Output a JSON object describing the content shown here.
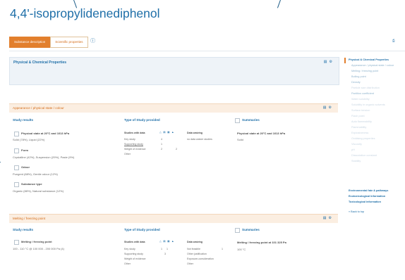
{
  "page": {
    "title": "4,4'-isopropylidenediphenol"
  },
  "tabs": [
    {
      "label": "Substance description",
      "active": true
    },
    {
      "label": "Scientific properties",
      "active": false
    }
  ],
  "info_icon": "info-icon",
  "physchem": {
    "title": "Physical & Chemical Properties"
  },
  "sections": [
    {
      "title": "Appearance / physical state / colour",
      "study_results_header": "Study results",
      "type_header": "Type of Study provided",
      "summaries_header": "Summaries",
      "results": [
        {
          "label": "Physical state at 20°C and 1013 hPa",
          "value": "Solid (78%), Liquid (22%)"
        },
        {
          "label": "Form",
          "value": "Crystalline (42%), Suspension (29%), Paste (9%)"
        },
        {
          "label": "Odour",
          "value": "Pungent (88%), Gentle odour (12%)"
        },
        {
          "label": "Substance type",
          "value": "Organic (88%), Natural substance (12%)"
        }
      ],
      "type_table": {
        "col_header": "Studies with data",
        "rows": [
          {
            "label": "Key study",
            "a": "4",
            "b": ""
          },
          {
            "label": "Supporting study",
            "a": "1",
            "b": ""
          },
          {
            "label": "Weight of evidence",
            "a": "2",
            "b": "2"
          },
          {
            "label": "Other",
            "a": "",
            "b": ""
          }
        ],
        "waiving_header": "Data waiving",
        "waiving_value": "no data waiver studies"
      },
      "summary": {
        "label": "Physical state at 20°C and 1013 hPa",
        "value": "Solid"
      }
    },
    {
      "title": "Melting / freezing point",
      "study_results_header": "Study results",
      "type_header": "Type of Study provided",
      "summaries_header": "Summaries",
      "results": [
        {
          "label": "Melting / freezing point",
          "value": "100 - 110 °C @ 100 000 - 200 000 Pa (4)"
        }
      ],
      "type_table": {
        "col_header": "Studies with data",
        "rows": [
          {
            "label": "Key study",
            "a": "1",
            "b": "1"
          },
          {
            "label": "Supporting study",
            "a": "3",
            "b": ""
          },
          {
            "label": "Weight of evidence",
            "a": "",
            "b": ""
          },
          {
            "label": "Other",
            "a": "",
            "b": ""
          }
        ],
        "waiving_header": "Data waiving",
        "waiving_rows": [
          {
            "label": "Not feasible",
            "a": "1"
          },
          {
            "label": "Other justification",
            "a": ""
          },
          {
            "label": "Exposure-consideration",
            "a": ""
          },
          {
            "label": "Other",
            "a": ""
          }
        ]
      },
      "summary": {
        "label": "Melting / freezing point at 101 325 Pa",
        "value": "100 °C"
      }
    }
  ],
  "sidebar": {
    "items": [
      {
        "label": "Physical & Chemical Properties",
        "style": "active"
      },
      {
        "label": "Appearance / physical state / colour",
        "style": "sub"
      },
      {
        "label": "Melting / freezing point",
        "style": "sub"
      },
      {
        "label": "Boiling point",
        "style": "sub"
      },
      {
        "label": "Density",
        "style": "sub"
      },
      {
        "label": "Particle size distribution",
        "style": "subdim"
      },
      {
        "label": "Partition coefficient",
        "style": "sub"
      },
      {
        "label": "Water solubility",
        "style": "subdim"
      },
      {
        "label": "Solubility in organic solvents",
        "style": "subdim"
      },
      {
        "label": "Surface tension",
        "style": "subdim"
      },
      {
        "label": "Flash point",
        "style": "subdim"
      },
      {
        "label": "Auto flammability",
        "style": "subdim"
      },
      {
        "label": "Flammability",
        "style": "subdim"
      },
      {
        "label": "Explosiveness",
        "style": "subdim"
      },
      {
        "label": "Oxidising properties",
        "style": "subdim"
      },
      {
        "label": "Viscosity",
        "style": "subdim"
      },
      {
        "label": "pH",
        "style": "subdim"
      },
      {
        "label": "Dissociation constant",
        "style": "subdim"
      },
      {
        "label": "Stability",
        "style": "subdim"
      },
      {
        "label": "Environmental fate & pathways",
        "style": "strong"
      },
      {
        "label": "Ecotoxicological Information",
        "style": "strong"
      },
      {
        "label": "Toxicological information",
        "style": "strong"
      },
      {
        "label": "» Back to top",
        "style": "plain"
      }
    ]
  },
  "colors": {
    "accent": "#1f6fa8",
    "orange": "#e27f2d",
    "section_bg": "#fbeee1"
  }
}
